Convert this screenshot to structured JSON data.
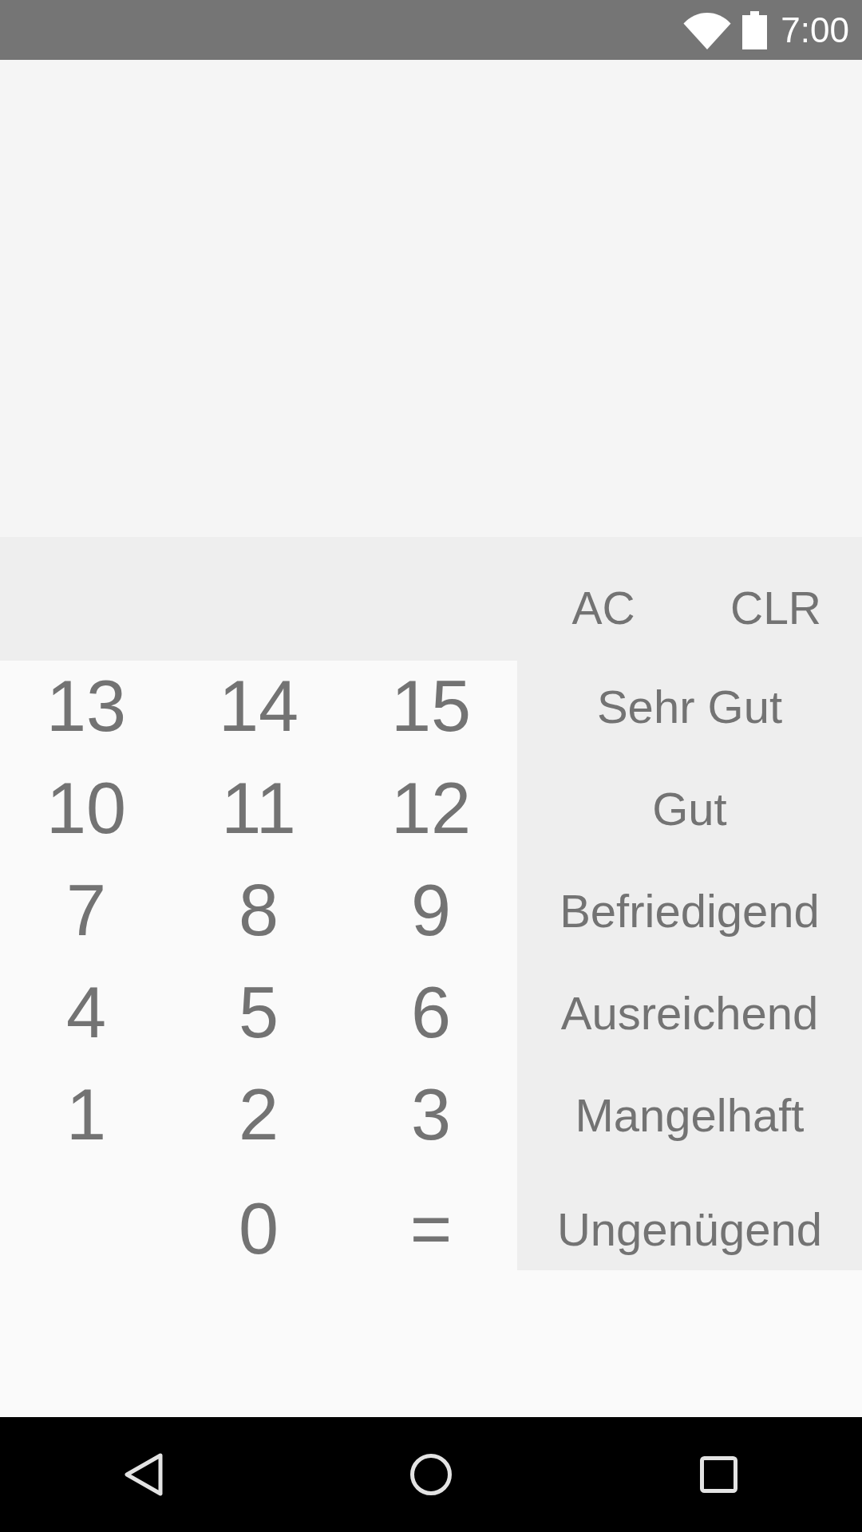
{
  "status_bar": {
    "time": "7:00"
  },
  "function_keys": [
    {
      "label": "AC"
    },
    {
      "label": "CLR"
    }
  ],
  "number_pad": {
    "rows": [
      [
        "13",
        "14",
        "15"
      ],
      [
        "10",
        "11",
        "12"
      ],
      [
        "7",
        "8",
        "9"
      ],
      [
        "4",
        "5",
        "6"
      ],
      [
        "1",
        "2",
        "3"
      ],
      [
        "",
        "0",
        "="
      ]
    ]
  },
  "grade_keys": [
    {
      "label": "Sehr Gut"
    },
    {
      "label": "Gut"
    },
    {
      "label": "Befriedigend"
    },
    {
      "label": "Ausreichend"
    },
    {
      "label": "Mangelhaft"
    },
    {
      "label": "Ungenügend"
    }
  ]
}
